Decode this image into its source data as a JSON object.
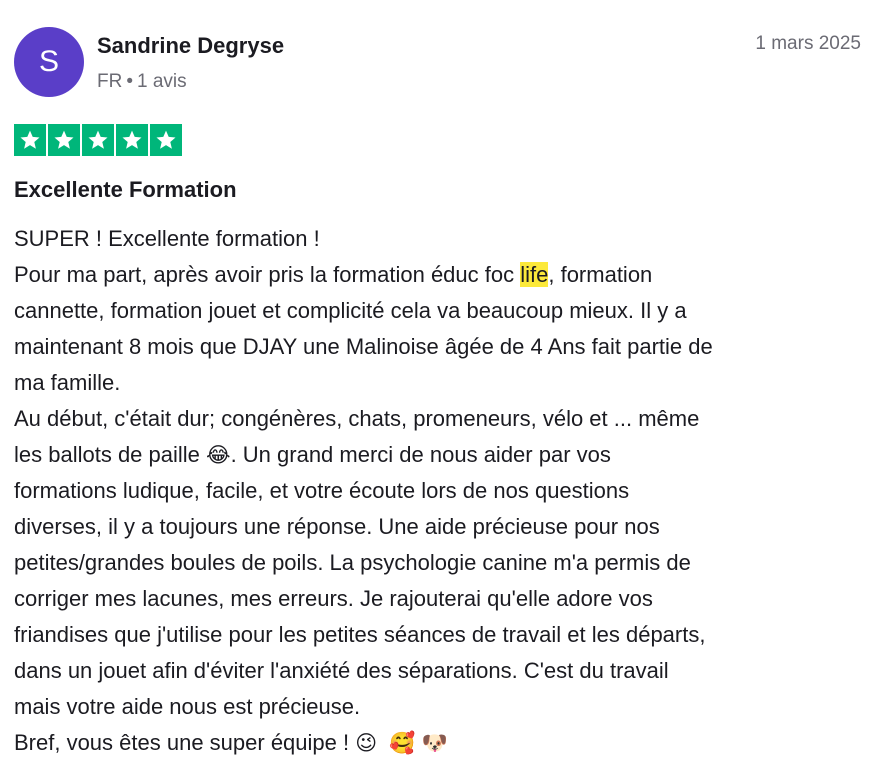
{
  "reviewer": {
    "initial": "S",
    "name": "Sandrine Degryse",
    "country": "FR",
    "separator": "•",
    "reviews_count": "1 avis"
  },
  "review": {
    "date": "1 mars 2025",
    "rating": 5,
    "rating_max": 5,
    "title": "Excellente Formation",
    "lines": {
      "l1": "SUPER ! Excellente formation !",
      "l2_before": "Pour ma part, après avoir pris la formation éduc foc ",
      "l2_highlight": "life",
      "l2_after": ", formation",
      "l3": "cannette, formation jouet et complicité cela va beaucoup mieux. Il y a",
      "l4": "maintenant 8 mois que DJAY une Malinoise âgée de 4 Ans fait partie de",
      "l5": "ma famille.",
      "l6": "Au début, c'était dur; congénères, chats, promeneurs, vélo et ... même",
      "l7_before": "les ballots de paille ",
      "l7_emoji": "😂",
      "l7_after": ". Un grand merci de nous aider par vos",
      "l8": "formations ludique, facile, et votre écoute lors de nos questions",
      "l9": "diverses, il y a toujours une réponse. Une aide précieuse pour nos",
      "l10": "petites/grandes boules de poils. La psychologie canine m'a permis de",
      "l11": "corriger mes lacunes, mes erreurs. Je rajouterai qu'elle adore vos",
      "l12": "friandises que j'utilise pour les petites séances de travail et les départs,",
      "l13": "dans un jouet afin d'éviter l'anxiété des séparations. C'est du travail",
      "l14": "mais votre aide nous est précieuse.",
      "l15_text": "Bref, vous êtes une super équipe ! ",
      "l15_emoji1": "😉",
      "l15_emoji2": "🥰",
      "l15_emoji3": "🐶"
    }
  },
  "colors": {
    "avatar_bg": "#5a3ec8",
    "star_bg": "#00b67a",
    "highlight": "#fce93a",
    "text": "#1b1b21",
    "muted": "#6b6b74"
  },
  "icons": {
    "star": "star-icon"
  }
}
